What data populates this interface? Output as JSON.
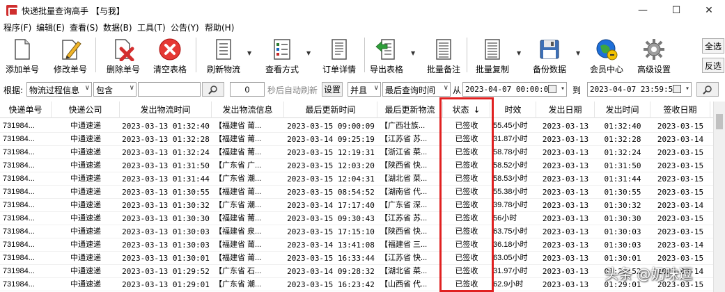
{
  "window": {
    "title": "快递批量查询高手 【与我】",
    "minimize": "—",
    "maximize": "☐",
    "close": "✕"
  },
  "menu": [
    "程序(F)",
    "编辑(E)",
    "查看(S)",
    "数据(B)",
    "工具(T)",
    "公告(Y)",
    "帮助(H)"
  ],
  "toolbar": {
    "items": [
      {
        "label": "添加单号",
        "icon": "add-document-icon"
      },
      {
        "label": "修改单号",
        "icon": "edit-pencil-icon"
      },
      {
        "label": "删除单号",
        "icon": "delete-x-icon"
      },
      {
        "label": "清空表格",
        "icon": "clear-red-circle-icon"
      },
      {
        "label": "刷新物流",
        "icon": "refresh-list-icon"
      },
      {
        "label": "查看方式",
        "icon": "view-checklist-icon"
      },
      {
        "label": "订单详情",
        "icon": "order-detail-icon"
      },
      {
        "label": "导出表格",
        "icon": "export-arrow-icon"
      },
      {
        "label": "批量备注",
        "icon": "batch-note-icon"
      },
      {
        "label": "批量复制",
        "icon": "batch-copy-icon"
      },
      {
        "label": "备份数据",
        "icon": "floppy-disk-icon"
      },
      {
        "label": "会员中心",
        "icon": "member-globe-icon"
      },
      {
        "label": "高级设置",
        "icon": "settings-gear-icon"
      }
    ],
    "select_all": "全选",
    "invert_select": "反选"
  },
  "filter": {
    "label": "根据:",
    "field": "物流过程信息",
    "match": "包含",
    "keyword": "",
    "seconds": "0",
    "auto_refresh_label": "秒后自动刷新",
    "settings_button": "设置",
    "logic": "并且",
    "time_field": "最后查询时间",
    "from_label": "从",
    "from_date": "2023-04-07 00:00:00",
    "to_label": "到",
    "to_date": "2023-04-07 23:59:59"
  },
  "table": {
    "columns": [
      "快递单号",
      "快递公司",
      "发出物流时间",
      "发出物流信息",
      "最后更新时间",
      "最后更新物流",
      "状态",
      "时效",
      "发出日期",
      "发出时间",
      "签收日期"
    ],
    "sort_indicator": "↓",
    "rows": [
      [
        "731984...",
        "中通速递",
        "2023-03-13 01:32:40",
        "【福建省 莆...",
        "2023-03-15 09:00:09",
        "【广西壮族...",
        "已签收",
        "55.45小时",
        "2023-03-13",
        "01:32:40",
        "2023-03-15"
      ],
      [
        "731984...",
        "中通速递",
        "2023-03-13 01:32:28",
        "【福建省 莆...",
        "2023-03-14 09:25:19",
        "【江苏省 苏...",
        "已签收",
        "31.87小时",
        "2023-03-13",
        "01:32:28",
        "2023-03-14"
      ],
      [
        "731984...",
        "中通速递",
        "2023-03-13 01:32:24",
        "【福建省 莆...",
        "2023-03-15 12:19:31",
        "【浙江省 菜...",
        "已签收",
        "58.78小时",
        "2023-03-13",
        "01:32:24",
        "2023-03-15"
      ],
      [
        "731984...",
        "中通速递",
        "2023-03-13 01:31:50",
        "【广东省 广...",
        "2023-03-15 12:03:20",
        "【陕西省 快...",
        "已签收",
        "58.52小时",
        "2023-03-13",
        "01:31:50",
        "2023-03-15"
      ],
      [
        "731984...",
        "中通速递",
        "2023-03-13 01:31:44",
        "【广东省 潮...",
        "2023-03-15 12:04:31",
        "【湖北省 菜...",
        "已签收",
        "58.53小时",
        "2023-03-13",
        "01:31:44",
        "2023-03-15"
      ],
      [
        "731984...",
        "中通速递",
        "2023-03-13 01:30:55",
        "【福建省 莆...",
        "2023-03-15 08:54:52",
        "【湖南省 代...",
        "已签收",
        "55.38小时",
        "2023-03-13",
        "01:30:55",
        "2023-03-15"
      ],
      [
        "731984...",
        "中通速递",
        "2023-03-13 01:30:32",
        "【广东省 潮...",
        "2023-03-14 17:17:40",
        "【广东省 深...",
        "已签收",
        "39.78小时",
        "2023-03-13",
        "01:30:32",
        "2023-03-14"
      ],
      [
        "731984...",
        "中通速递",
        "2023-03-13 01:30:30",
        "【福建省 莆...",
        "2023-03-15 09:30:43",
        "【江苏省 苏...",
        "已签收",
        "56小时",
        "2023-03-13",
        "01:30:30",
        "2023-03-15"
      ],
      [
        "731984...",
        "中通速递",
        "2023-03-13 01:30:03",
        "【福建省 泉...",
        "2023-03-15 17:15:10",
        "【陕西省 快...",
        "已签收",
        "63.75小时",
        "2023-03-13",
        "01:30:03",
        "2023-03-15"
      ],
      [
        "731984...",
        "中通速递",
        "2023-03-13 01:30:03",
        "【福建省 莆...",
        "2023-03-14 13:41:08",
        "【福建省 三...",
        "已签收",
        "36.18小时",
        "2023-03-13",
        "01:30:03",
        "2023-03-14"
      ],
      [
        "731984...",
        "中通速递",
        "2023-03-13 01:30:01",
        "【福建省 莆...",
        "2023-03-15 16:33:44",
        "【江苏省 快...",
        "已签收",
        "63.05小时",
        "2023-03-13",
        "01:30:01",
        "2023-03-15"
      ],
      [
        "731984...",
        "中通速递",
        "2023-03-13 01:29:52",
        "【广东省 石...",
        "2023-03-14 09:28:32",
        "【湖北省 菜...",
        "已签收",
        "31.97小时",
        "2023-03-13",
        "01:29:52",
        "2023-03-14"
      ],
      [
        "731984...",
        "中通速递",
        "2023-03-13 01:29:01",
        "【广东省 潮...",
        "2023-03-15 16:23:42",
        "【山西省 代...",
        "已签收",
        "62.9小时",
        "2023-03-13",
        "01:29:01",
        "2023-03-15"
      ]
    ]
  },
  "watermark": "头条 @奶味逗",
  "colors": {
    "highlight": "#e02020",
    "app_icon": "#cf2e2e"
  }
}
